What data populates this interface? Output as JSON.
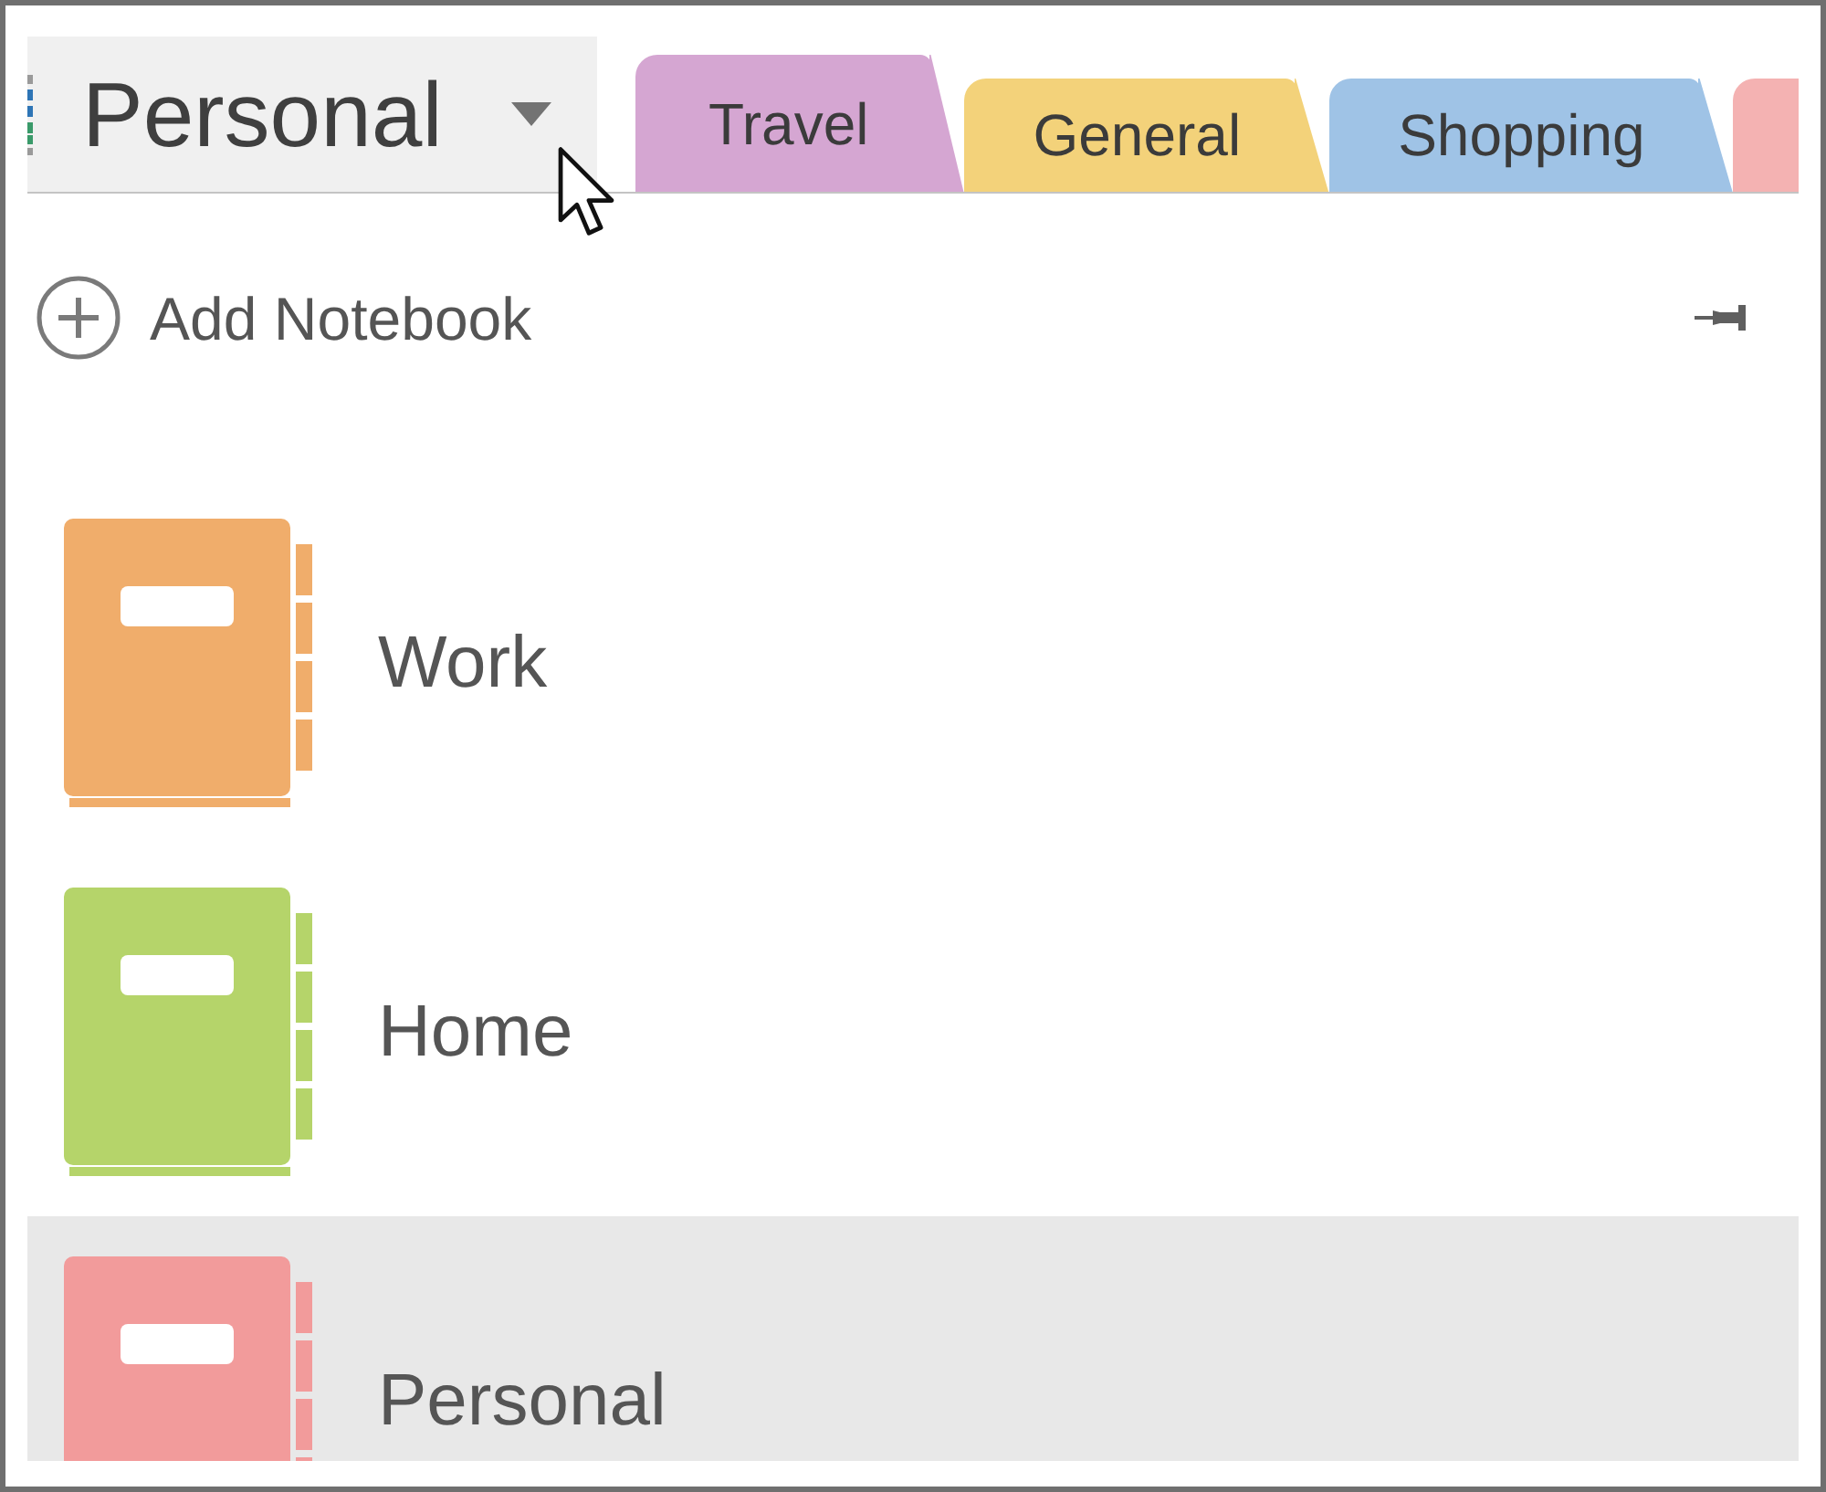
{
  "notebook_picker": {
    "label": "Personal"
  },
  "tabs": [
    {
      "label": "Travel",
      "color": "#d5a6d2",
      "selected": true
    },
    {
      "label": "General",
      "color": "#f3d27a",
      "selected": false
    },
    {
      "label": "Shopping",
      "color": "#9fc3e6",
      "selected": false
    },
    {
      "color": "#f4b2b2",
      "selected": false
    }
  ],
  "add_notebook": {
    "label": "Add Notebook"
  },
  "notebooks": [
    {
      "name": "Work",
      "color": "#f0ad6b",
      "selected": false
    },
    {
      "name": "Home",
      "color": "#b5d46a",
      "selected": false
    },
    {
      "name": "Personal",
      "color": "#f29b9b",
      "selected": true
    }
  ]
}
